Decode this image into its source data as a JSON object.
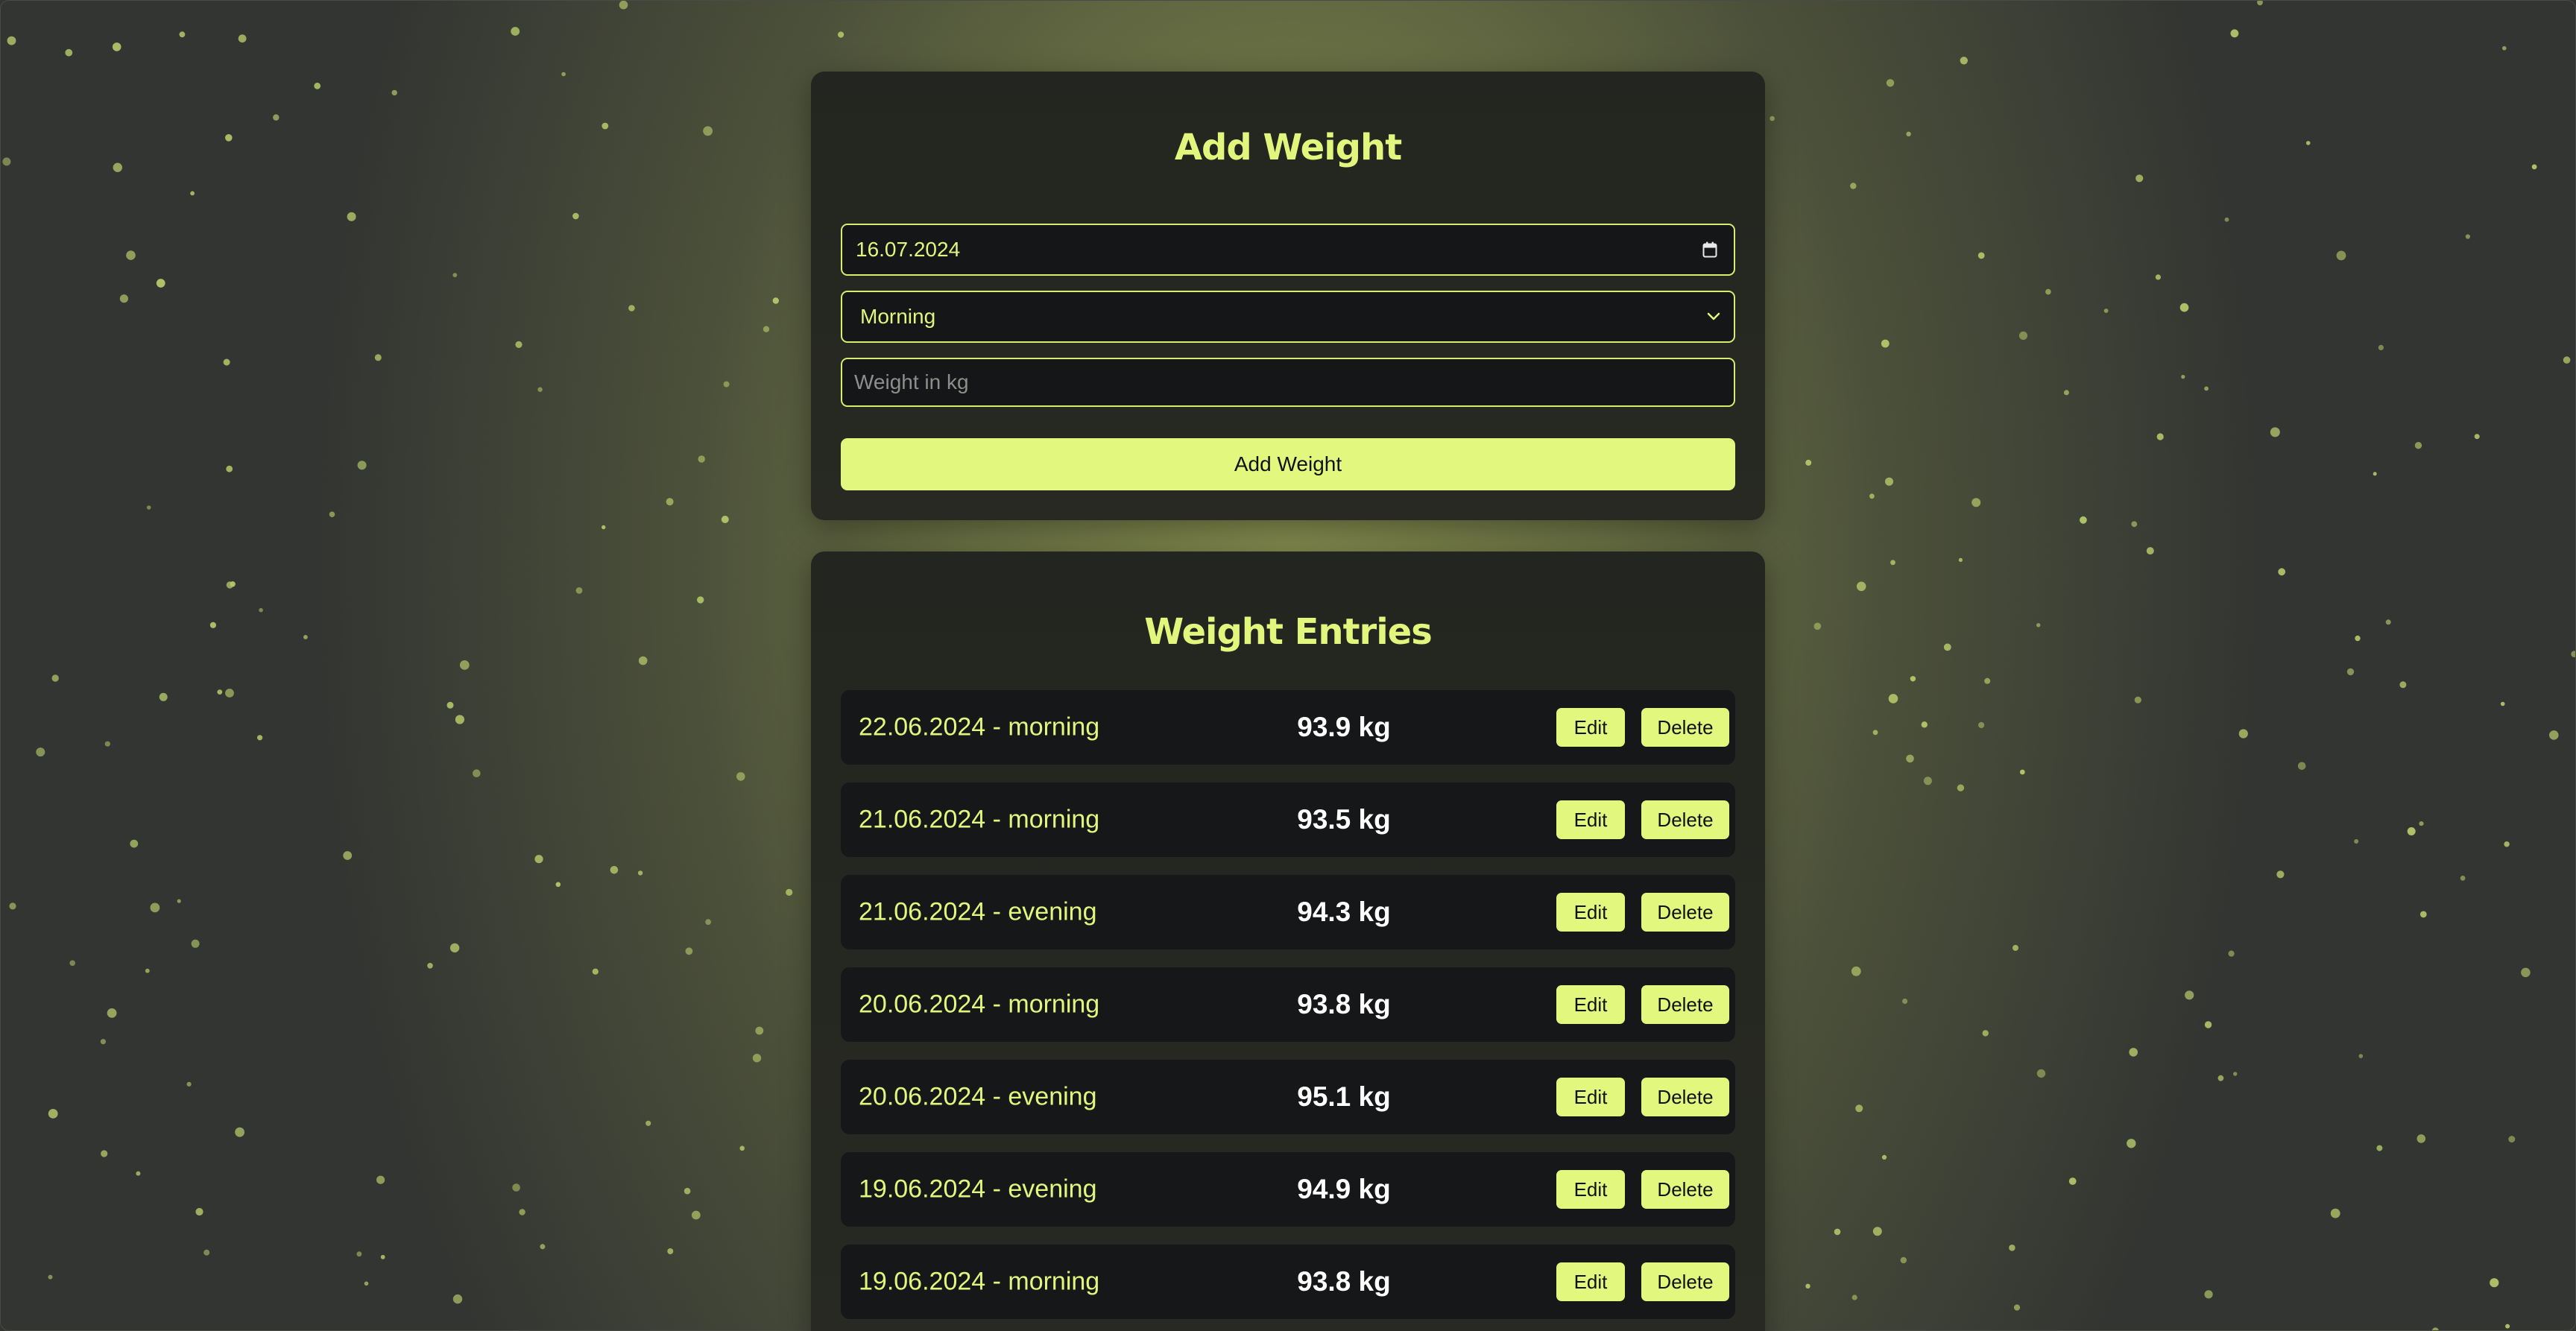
{
  "add_form": {
    "title": "Add Weight",
    "date_value": "16.07.2024",
    "time_of_day_selected": "Morning",
    "weight_placeholder": "Weight in kg",
    "submit_label": "Add Weight"
  },
  "entries_section": {
    "title": "Weight Entries",
    "edit_label": "Edit",
    "delete_label": "Delete",
    "entries": [
      {
        "label": "22.06.2024 - morning",
        "weight": "93.9 kg"
      },
      {
        "label": "21.06.2024 - morning",
        "weight": "93.5 kg"
      },
      {
        "label": "21.06.2024 - evening",
        "weight": "94.3 kg"
      },
      {
        "label": "20.06.2024 - morning",
        "weight": "93.8 kg"
      },
      {
        "label": "20.06.2024 - evening",
        "weight": "95.1 kg"
      },
      {
        "label": "19.06.2024 - evening",
        "weight": "94.9 kg"
      },
      {
        "label": "19.06.2024 - morning",
        "weight": "93.8 kg"
      }
    ]
  },
  "colors": {
    "accent": "#e2f77d",
    "card_background": "#252720",
    "field_background": "#151617",
    "row_background": "#161718",
    "background_center": "#848c4f",
    "background_edge": "#333532"
  },
  "icons": {
    "date_field_icon": "calendar-icon",
    "select_field_icon": "chevron-down-icon"
  }
}
